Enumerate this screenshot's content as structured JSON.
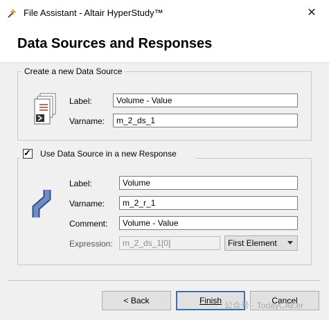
{
  "window": {
    "title": "File Assistant - Altair HyperStudy™",
    "close_glyph": "✕",
    "app_icon": "altair-wizard-icon"
  },
  "header": {
    "title": "Data Sources and Responses"
  },
  "data_source_group": {
    "legend": "Create a new Data Source",
    "icon": "data-source-file-icon",
    "label_caption": "Label:",
    "label_value": "Volume - Value",
    "varname_caption": "Varname:",
    "varname_value": "m_2_ds_1"
  },
  "response_group": {
    "checkbox_label": "Use Data Source in a new Response",
    "checkbox_checked": true,
    "checkmark": "✓",
    "icon": "response-curve-icon",
    "label_caption": "Label:",
    "label_value": "Volume",
    "varname_caption": "Varname:",
    "varname_value": "m_2_r_1",
    "comment_caption": "Comment:",
    "comment_value": "Volume - Value",
    "expression_caption": "Expression:",
    "expression_value": "m_2_ds_1[0]",
    "expression_option": "First Element"
  },
  "buttons": {
    "back_label": "< Back",
    "finish_label": "Finish",
    "cancel_label": "Cancel"
  },
  "watermark": "公众号 · TodayCAEer"
}
